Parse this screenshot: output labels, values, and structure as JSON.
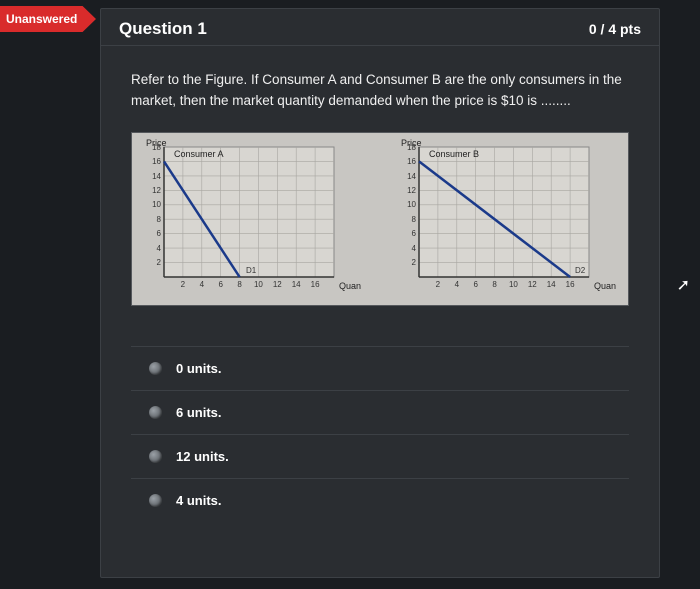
{
  "flag": "Unanswered",
  "header": {
    "title": "Question 1",
    "points": "0 / 4 pts"
  },
  "prompt": "Refer to the Figure. If Consumer A and Consumer B are the only consumers in the market, then the market quantity demanded when the price is $10 is ........",
  "chart_data": [
    {
      "type": "line",
      "title": "Consumer A",
      "ylabel": "Price",
      "xlabel": "Quantity",
      "series_label": "D1",
      "x": [
        0,
        8
      ],
      "y": [
        16,
        0
      ],
      "xlim": [
        0,
        18
      ],
      "ylim": [
        0,
        18
      ],
      "xticks": [
        2,
        4,
        6,
        8,
        10,
        12,
        14,
        16
      ],
      "yticks": [
        2,
        4,
        6,
        8,
        10,
        12,
        14,
        16,
        18
      ]
    },
    {
      "type": "line",
      "title": "Consumer B",
      "ylabel": "Price",
      "xlabel": "Quantity",
      "series_label": "D2",
      "x": [
        0,
        16
      ],
      "y": [
        16,
        0
      ],
      "xlim": [
        0,
        18
      ],
      "ylim": [
        0,
        18
      ],
      "xticks": [
        2,
        4,
        6,
        8,
        10,
        12,
        14,
        16
      ],
      "yticks": [
        2,
        4,
        6,
        8,
        10,
        12,
        14,
        16,
        18
      ]
    }
  ],
  "answers": [
    {
      "label": "0 units."
    },
    {
      "label": "6 units."
    },
    {
      "label": "12 units."
    },
    {
      "label": "4 units."
    }
  ]
}
